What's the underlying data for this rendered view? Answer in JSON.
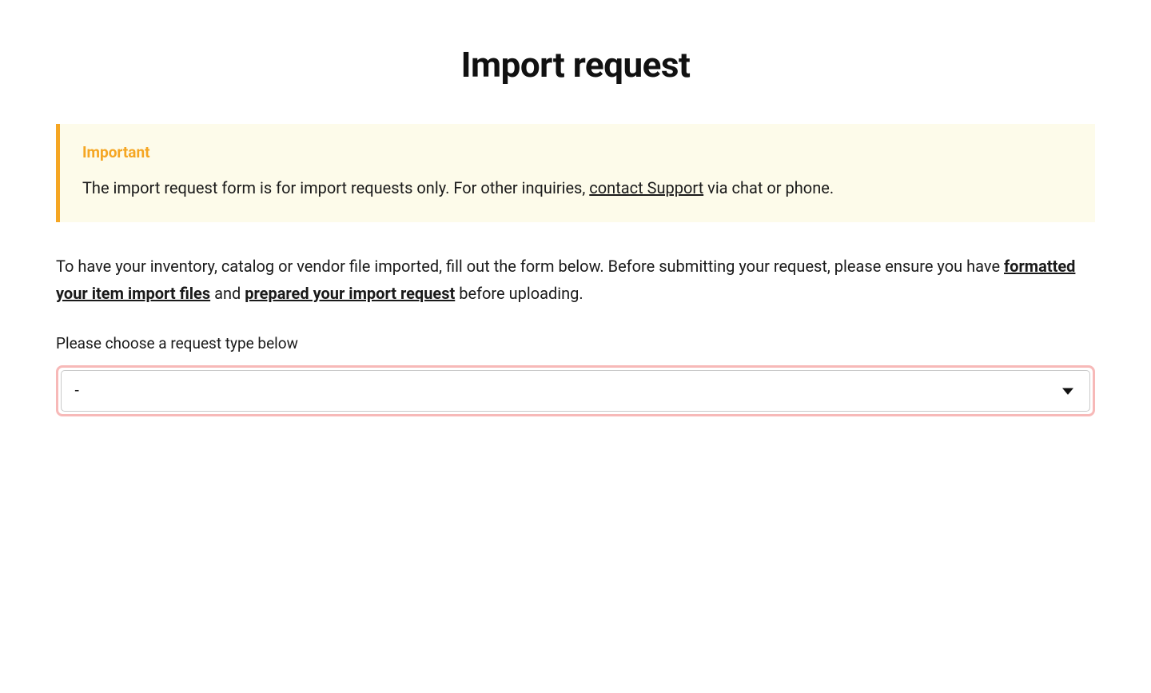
{
  "page": {
    "title": "Import request"
  },
  "callout": {
    "title": "Important",
    "body_pre": "The import request form is for import requests only. For other inquiries, ",
    "link_text": "contact Support",
    "body_post": " via chat or phone."
  },
  "instructions": {
    "pre": "To have your inventory, catalog or vendor file imported, fill out the form below. Before submitting your request, please ensure you have ",
    "link1": "formatted your item import files",
    "mid": " and ",
    "link2": "prepared your import request",
    "post": " before uploading."
  },
  "form": {
    "request_type_label": "Please choose a request type below",
    "request_type_selected": "-"
  }
}
